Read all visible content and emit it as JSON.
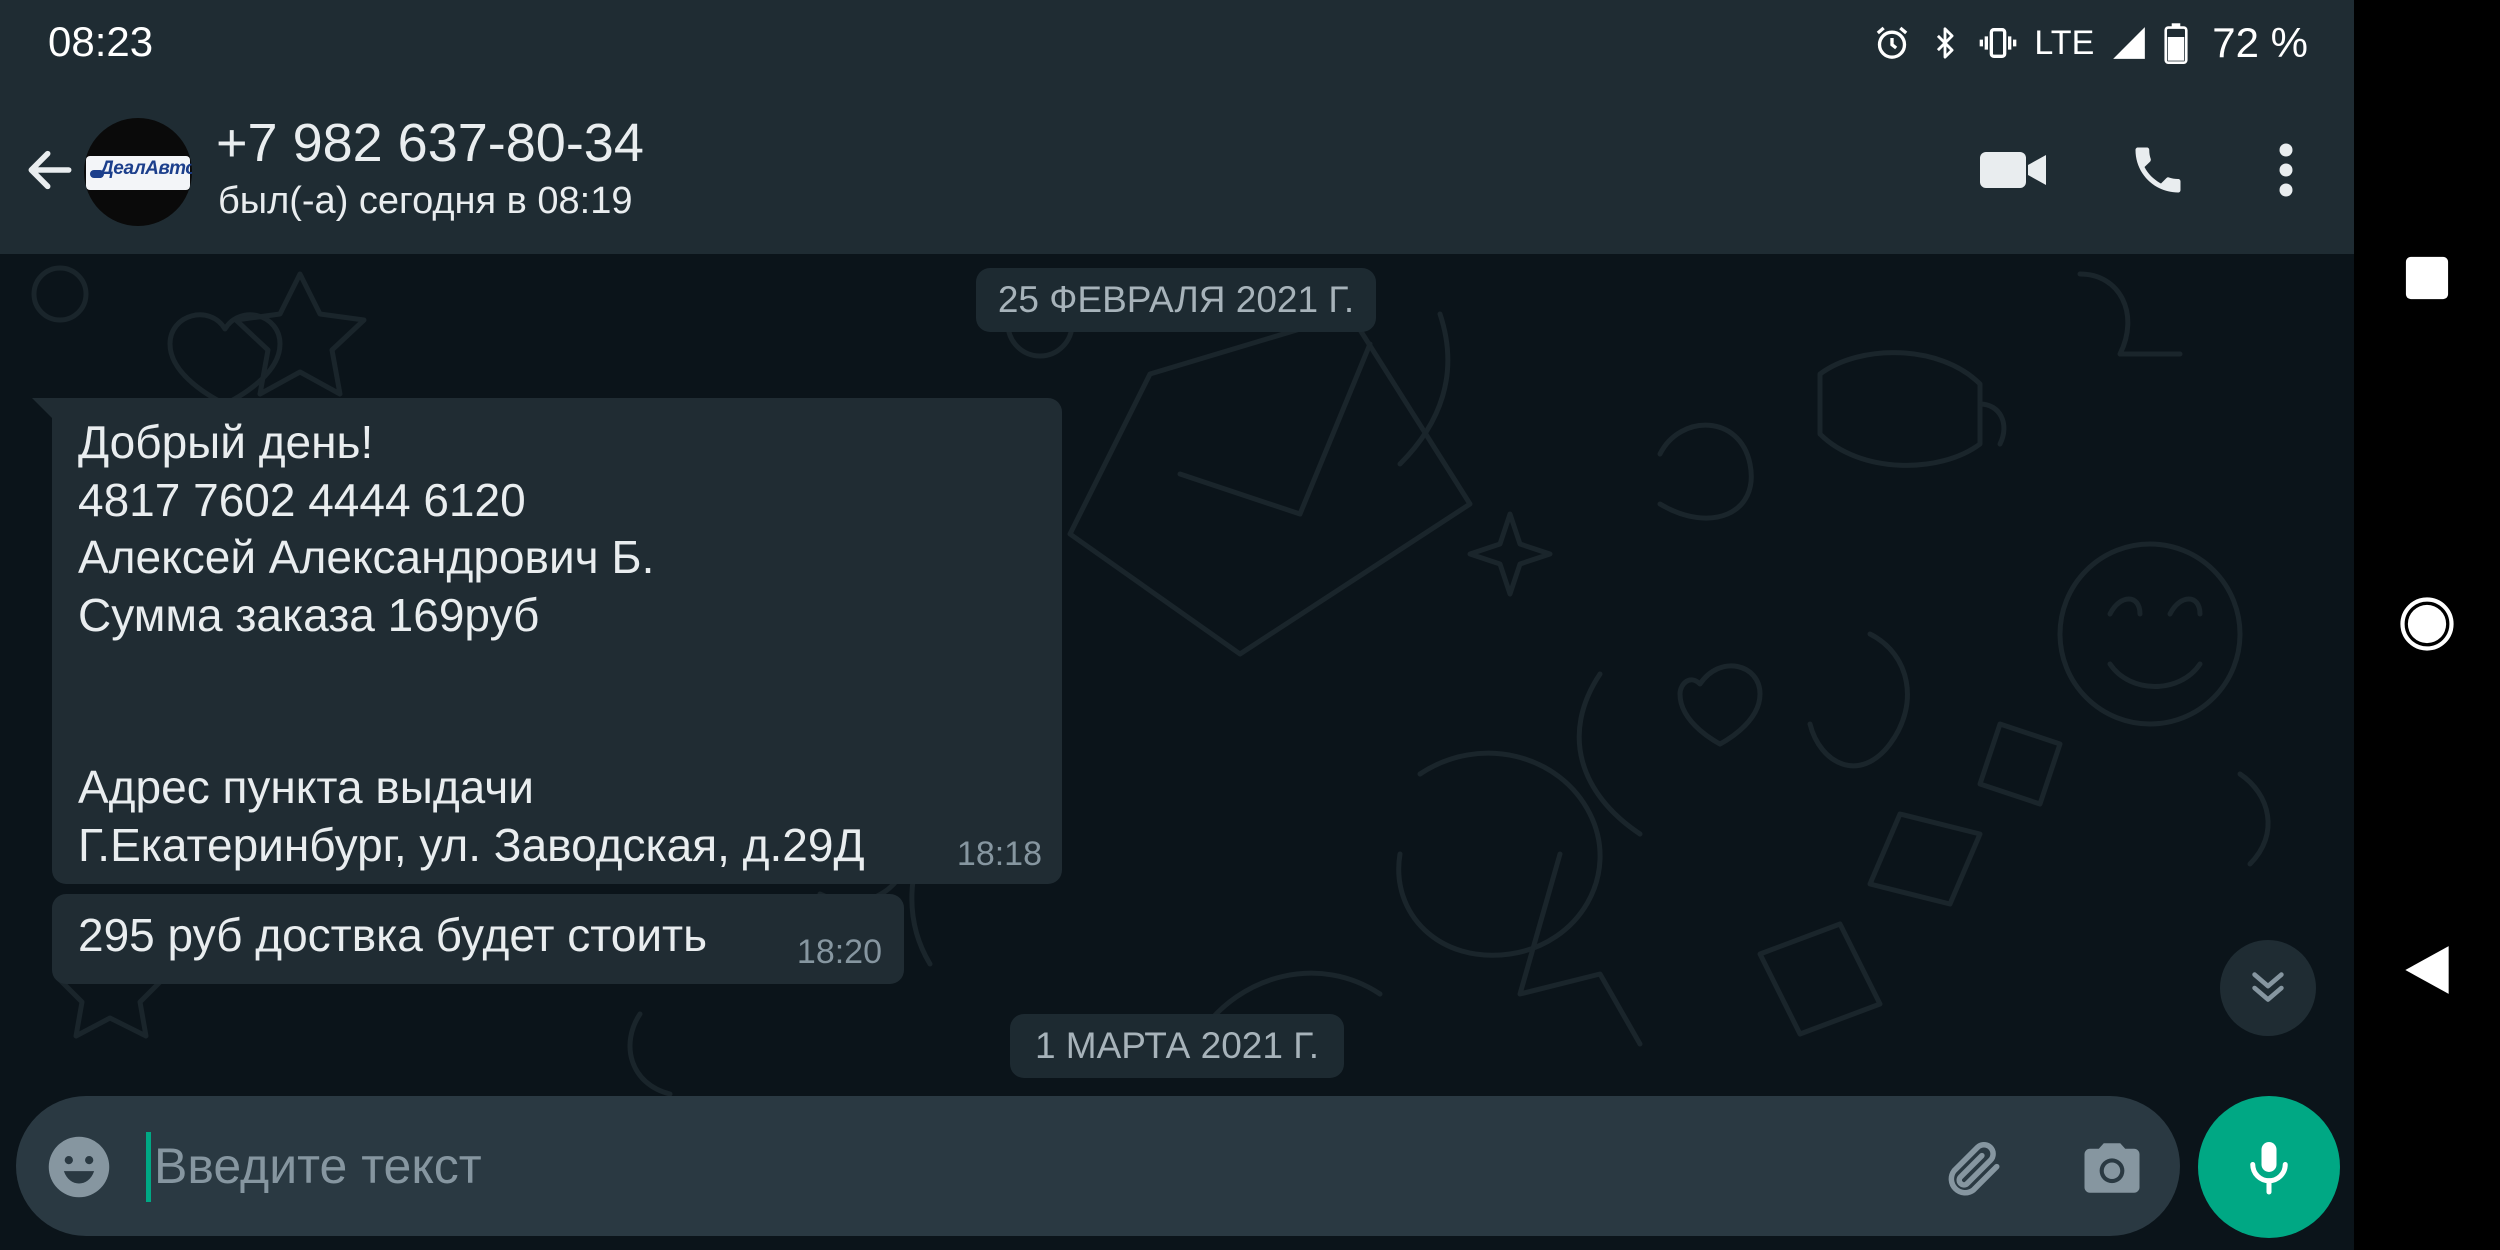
{
  "status_bar": {
    "time": "08:23",
    "network": "LTE",
    "battery": "72 %",
    "icons": [
      "alarm-icon",
      "bluetooth-icon",
      "vibrate-icon",
      "signal-icon",
      "battery-icon"
    ]
  },
  "header": {
    "contact_name": "+7 982 637-80-34",
    "last_seen": "был(-а) сегодня в 08:19",
    "avatar_logo_text": "ДеалАвто",
    "icons": [
      "back-arrow-icon",
      "video-call-icon",
      "phone-icon",
      "more-vert-icon"
    ]
  },
  "chat": {
    "date_chips": [
      "25 ФЕВРАЛЯ 2021 Г.",
      "1 МАРТА 2021 Г."
    ],
    "messages": [
      {
        "lines": [
          "Добрый день!",
          "4817 7602 4444 6120",
          "Алексей Александрович Б.",
          "Сумма заказа 169руб",
          "",
          "",
          "Адрес пункта выдачи",
          "Г.Екатеринбург, ул. Заводская, д.29Д"
        ],
        "time": "18:18"
      },
      {
        "text": "295 руб доствка будет стоить",
        "time": "18:20"
      }
    ]
  },
  "composer": {
    "placeholder": "Введите текст",
    "value": ""
  },
  "colors": {
    "background": "#0b141a",
    "bar": "#1f2c33",
    "bubble_incoming": "#202c33",
    "input": "#2a3942",
    "accent": "#00a884",
    "secondary_text": "#8696a0"
  }
}
